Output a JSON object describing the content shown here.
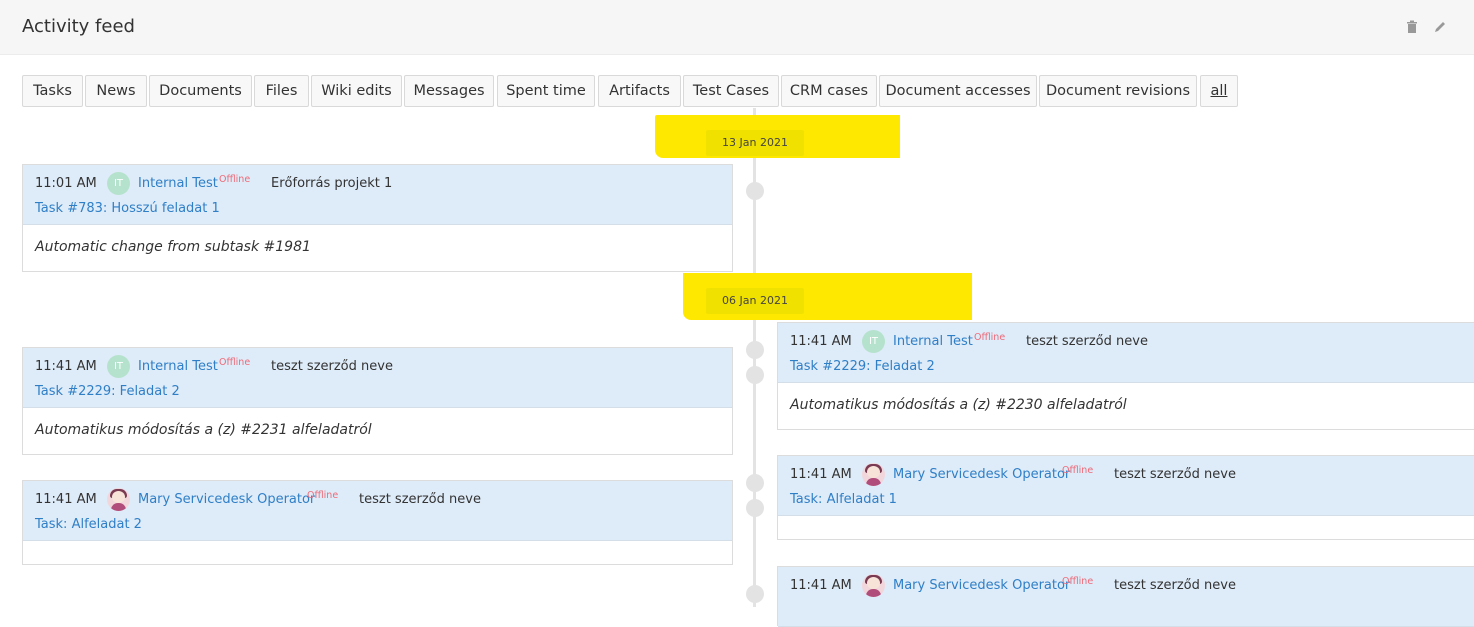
{
  "header": {
    "title": "Activity feed",
    "trash_icon": "trash-icon",
    "edit_icon": "pencil-icon"
  },
  "tabs": [
    "Tasks",
    "News",
    "Documents",
    "Files",
    "Wiki edits",
    "Messages",
    "Spent time",
    "Artifacts",
    "Test Cases",
    "CRM cases",
    "Document accesses",
    "Document revisions",
    "all"
  ],
  "dates": [
    "13 Jan 2021",
    "06 Jan 2021"
  ],
  "colors": {
    "highlight": "#ffe800",
    "card_head": "#deebf8",
    "link": "#2f7fc7",
    "offline": "#ee6a78"
  },
  "entries": [
    {
      "time": "11:01 AM",
      "avatar": "IT",
      "user": "Internal Test",
      "status": "Offline",
      "project": "Erőforrás projekt 1",
      "task": "Task #783: Hosszú feladat 1",
      "body": "Automatic change from subtask #1981"
    },
    {
      "time": "11:41 AM",
      "avatar": "IT",
      "user": "Internal Test",
      "status": "Offline",
      "project": "teszt szerződ neve",
      "task": "Task #2229: Feladat 2",
      "body": "Automatikus módosítás a (z) #2230 alfeladatról"
    },
    {
      "time": "11:41 AM",
      "avatar": "IT",
      "user": "Internal Test",
      "status": "Offline",
      "project": "teszt szerződ neve",
      "task": "Task #2229: Feladat 2",
      "body": "Automatikus módosítás a (z) #2231 alfeladatról"
    },
    {
      "time": "11:41 AM",
      "avatar": "user-photo",
      "user": "Mary Servicedesk Operator",
      "status": "Offline",
      "project": "teszt szerződ neve",
      "task": "Task: Alfeladat 1",
      "body": ""
    },
    {
      "time": "11:41 AM",
      "avatar": "user-photo",
      "user": "Mary Servicedesk Operator",
      "status": "Offline",
      "project": "teszt szerződ neve",
      "task": "Task: Alfeladat 2",
      "body": ""
    },
    {
      "time": "11:41 AM",
      "avatar": "user-photo",
      "user": "Mary Servicedesk Operator",
      "status": "Offline",
      "project": "teszt szerződ neve",
      "task": "",
      "body": ""
    }
  ]
}
